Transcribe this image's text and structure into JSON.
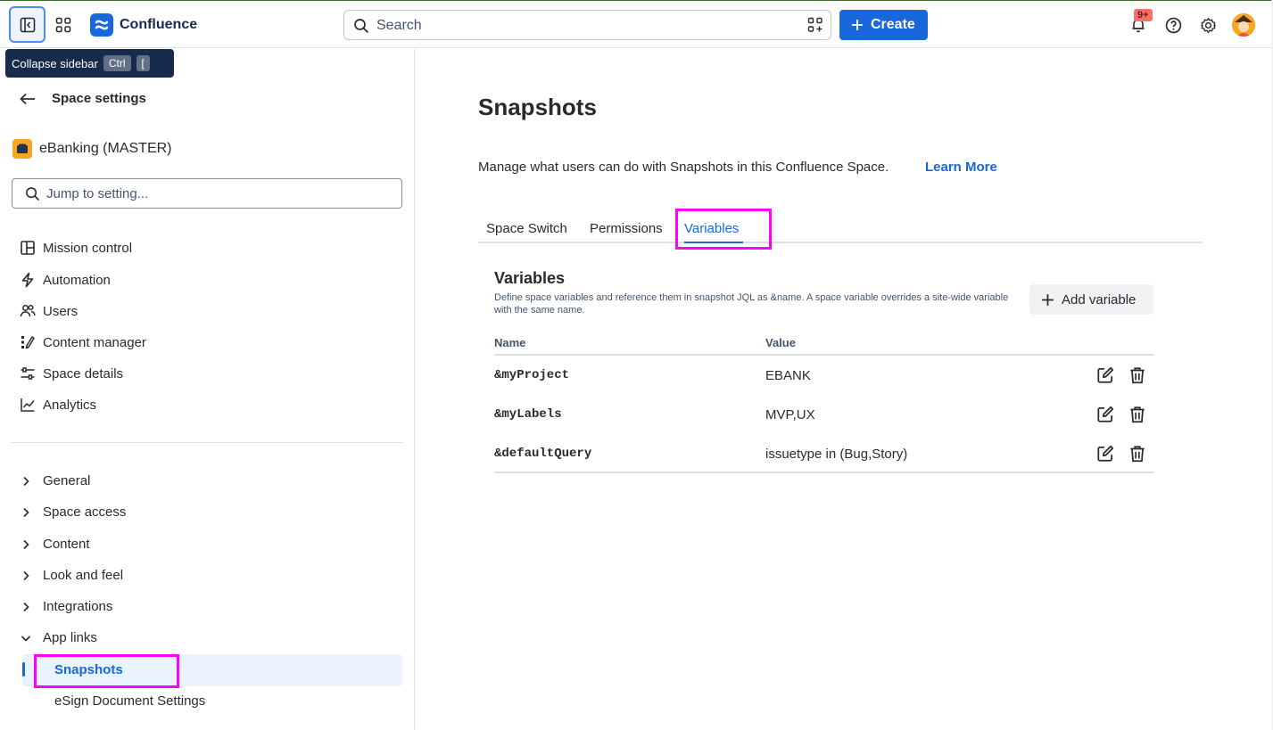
{
  "topbar": {
    "app_name": "Confluence",
    "search_placeholder": "Search",
    "create_label": "Create",
    "notifications_badge": "9+"
  },
  "tooltip": {
    "text": "Collapse sidebar",
    "key1": "Ctrl",
    "key2": "["
  },
  "sidebar": {
    "back_title": "Space settings",
    "space_name": "eBanking (MASTER)",
    "jump_placeholder": "Jump to setting...",
    "nav": [
      {
        "label": "Mission control",
        "icon": "layout-icon"
      },
      {
        "label": "Automation",
        "icon": "lightning-icon"
      },
      {
        "label": "Users",
        "icon": "people-icon"
      },
      {
        "label": "Content manager",
        "icon": "content-manager-icon"
      },
      {
        "label": "Space details",
        "icon": "sliders-icon"
      },
      {
        "label": "Analytics",
        "icon": "chart-icon"
      }
    ],
    "tree": [
      {
        "label": "General",
        "expanded": false
      },
      {
        "label": "Space access",
        "expanded": false
      },
      {
        "label": "Content",
        "expanded": false
      },
      {
        "label": "Look and feel",
        "expanded": false
      },
      {
        "label": "Integrations",
        "expanded": false
      },
      {
        "label": "App links",
        "expanded": true
      }
    ],
    "sub_items": [
      "Snapshots",
      "eSign Document Settings"
    ]
  },
  "main": {
    "title": "Snapshots",
    "description": "Manage what users can do with Snapshots in this Confluence Space.",
    "learn_more": "Learn More",
    "tabs": [
      "Space Switch",
      "Permissions",
      "Variables"
    ],
    "active_tab": "Variables",
    "section": {
      "title": "Variables",
      "description": "Define space variables and reference them in snapshot JQL as &name. A space variable overrides a site-wide variable with the same name.",
      "add_label": "Add variable"
    },
    "table": {
      "headers": [
        "Name",
        "Value"
      ],
      "rows": [
        {
          "name": "&myProject",
          "value": "EBANK"
        },
        {
          "name": "&myLabels",
          "value": "MVP,UX"
        },
        {
          "name": "&defaultQuery",
          "value": "issuetype in (Bug,Story)"
        }
      ]
    }
  },
  "colors": {
    "accent": "#1868DB",
    "highlight": "#FF00FF"
  }
}
